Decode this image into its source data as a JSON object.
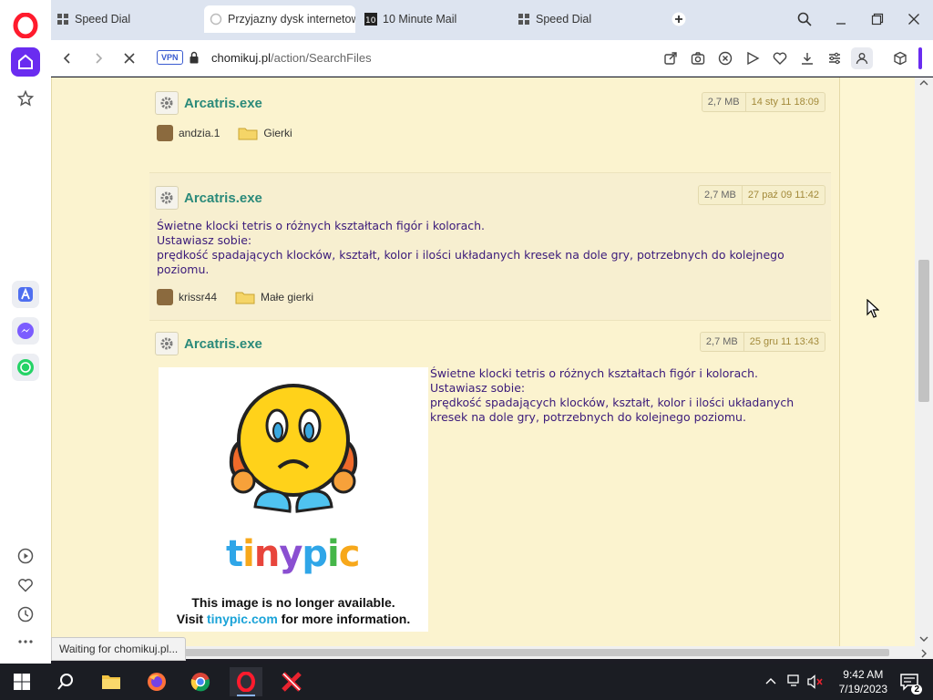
{
  "tabs": [
    {
      "label": "Speed Dial",
      "active": false
    },
    {
      "label": "Przyjazny dysk internetow",
      "active": true
    },
    {
      "label": "10 Minute Mail",
      "active": false
    },
    {
      "label": "Speed Dial",
      "active": false
    }
  ],
  "addressbar": {
    "vpn": "VPN",
    "domain": "chomikuj.pl",
    "path": "/action/SearchFiles"
  },
  "files": [
    {
      "name": "Arcatris.exe",
      "size": "2,7 MB",
      "date": "14 sty 11 18:09",
      "user": "andzia.1",
      "folder": "Gierki"
    },
    {
      "name": "Arcatris.exe",
      "size": "2,7 MB",
      "date": "27 paź 09 11:42",
      "description": [
        "Świetne klocki tetris o różnych kształtach figór i kolorach.",
        "Ustawiasz sobie:",
        "prędkość spadających klocków, kształt, kolor i ilości układanych kresek na dole gry, potrzebnych do kolejnego",
        "poziomu."
      ],
      "user": "krissr44",
      "folder": "Małe gierki"
    },
    {
      "name": "Arcatris.exe",
      "size": "2,7 MB",
      "date": "25 gru 11 13:43",
      "description": [
        "Świetne klocki tetris o różnych kształtach figór i kolorach.",
        "Ustawiasz sobie:",
        "prędkość spadających klocków, kształt, kolor i ilości układanych",
        "kresek na dole gry, potrzebnych do kolejnego poziomu."
      ],
      "image": {
        "logo": "tinypic",
        "line1": "This image is no longer available.",
        "line2_prefix": "Visit ",
        "line2_link": "tinypic.com",
        "line2_suffix": " for more information."
      }
    }
  ],
  "status": "Waiting for chomikuj.pl...",
  "clock": {
    "time": "9:42 AM",
    "date": "7/19/2023"
  },
  "notifications": "2",
  "colors": {
    "opera_red": "#ff1b2d",
    "sidebar_accent": "#6a2cf0",
    "file_link": "#2b8a7a",
    "description_text": "#3a1a7a",
    "page_bg": "#fdf6d3"
  }
}
